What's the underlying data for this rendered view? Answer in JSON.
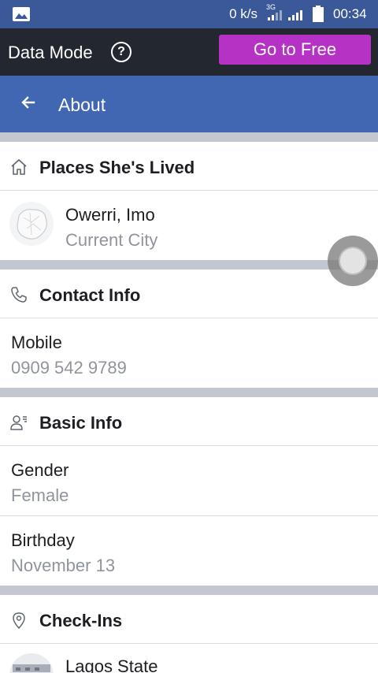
{
  "statusbar": {
    "net_speed": "0 k/s",
    "net_type": "3G",
    "time": "00:34"
  },
  "data_mode": {
    "label": "Data Mode",
    "help_symbol": "?",
    "go_free_label": "Go to Free",
    "go_free_color": "#b632c4"
  },
  "appbar": {
    "title": "About",
    "color": "#4267b2"
  },
  "places": {
    "header": "Places She's Lived",
    "icon": "home-icon",
    "item": {
      "primary": "Owerri, Imo",
      "secondary": "Current City"
    }
  },
  "contact": {
    "header": "Contact Info",
    "icon": "phone-icon",
    "item": {
      "primary": "Mobile",
      "secondary": "0909 542 9789"
    }
  },
  "basic": {
    "header": "Basic Info",
    "icon": "person-card-icon",
    "items": [
      {
        "primary": "Gender",
        "secondary": "Female"
      },
      {
        "primary": "Birthday",
        "secondary": "November 13"
      }
    ]
  },
  "checkins": {
    "header": "Check-Ins",
    "icon": "location-pin-icon",
    "item": {
      "primary": "Lagos State"
    }
  }
}
